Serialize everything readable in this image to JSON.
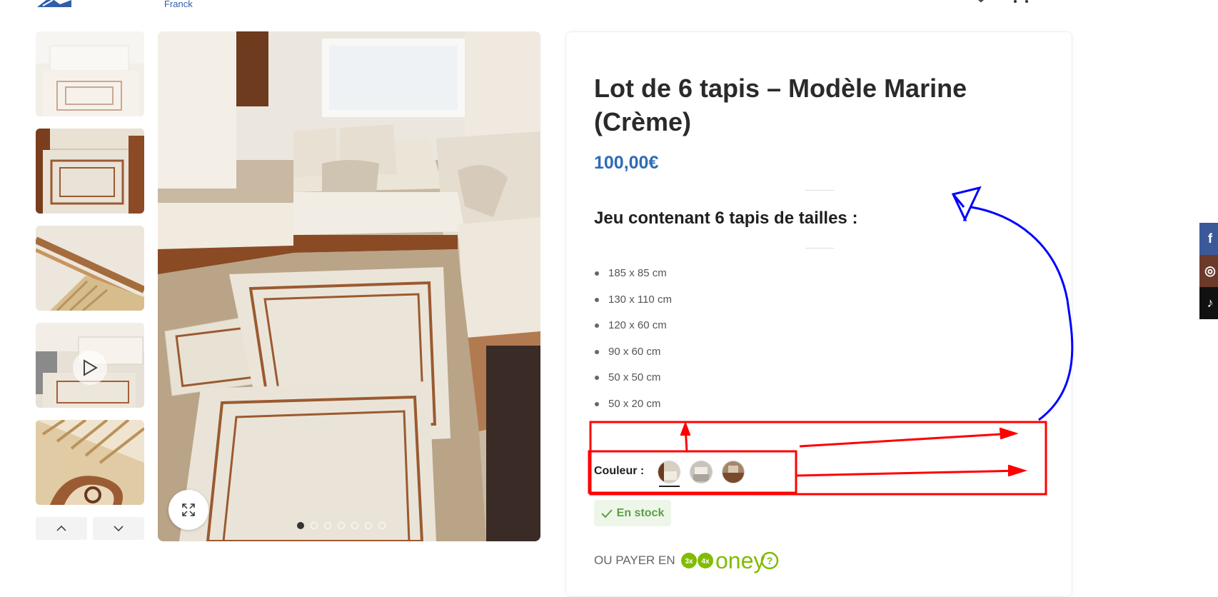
{
  "header": {
    "logo_subtitle": "Franck",
    "icons": [
      "user-icon",
      "heart-icon",
      "cart-icon"
    ]
  },
  "gallery": {
    "thumbnails": [
      {
        "name": "thumb-rug-lounge",
        "active": true
      },
      {
        "name": "thumb-rug-room"
      },
      {
        "name": "thumb-rug-closeup"
      },
      {
        "name": "thumb-video",
        "video": true
      },
      {
        "name": "thumb-rug-detail"
      }
    ],
    "nav_icons": [
      "chevron-up-icon",
      "chevron-down-icon"
    ],
    "slide_count": 7,
    "active_slide": 0,
    "zoom_icon": "expand-icon"
  },
  "product": {
    "title": "Lot de 6 tapis – Modèle Marine (Crème)",
    "price": "100,00€",
    "price_color": "#2f6bb8",
    "subtitle": "Jeu contenant 6 tapis de tailles :",
    "sizes": [
      "185 x 85 cm",
      "130 x 110 cm",
      "120 x 60 cm",
      "90 x 60 cm",
      "50 x 50 cm",
      "50 x 20 cm"
    ],
    "color_label": "Couleur :",
    "color_swatches": [
      "swatch-creme",
      "swatch-grey",
      "swatch-brown"
    ],
    "selected_swatch": 0,
    "stock_label": "En stock",
    "stock_color": "#5aa044",
    "payment_label": "OU PAYER EN",
    "payment_brand": "oney",
    "payment_options": [
      "3x",
      "4x"
    ],
    "payment_color": "#81bc00"
  },
  "social": [
    {
      "icon": "facebook-icon",
      "glyph": "f",
      "color": "#3b5998"
    },
    {
      "icon": "instagram-icon",
      "glyph": "◎",
      "color": "#6b3a2a"
    },
    {
      "icon": "tiktok-icon",
      "glyph": "♪",
      "color": "#111111"
    }
  ],
  "annotations": {
    "red_color": "#ff0000",
    "blue_color": "#0000ff"
  }
}
